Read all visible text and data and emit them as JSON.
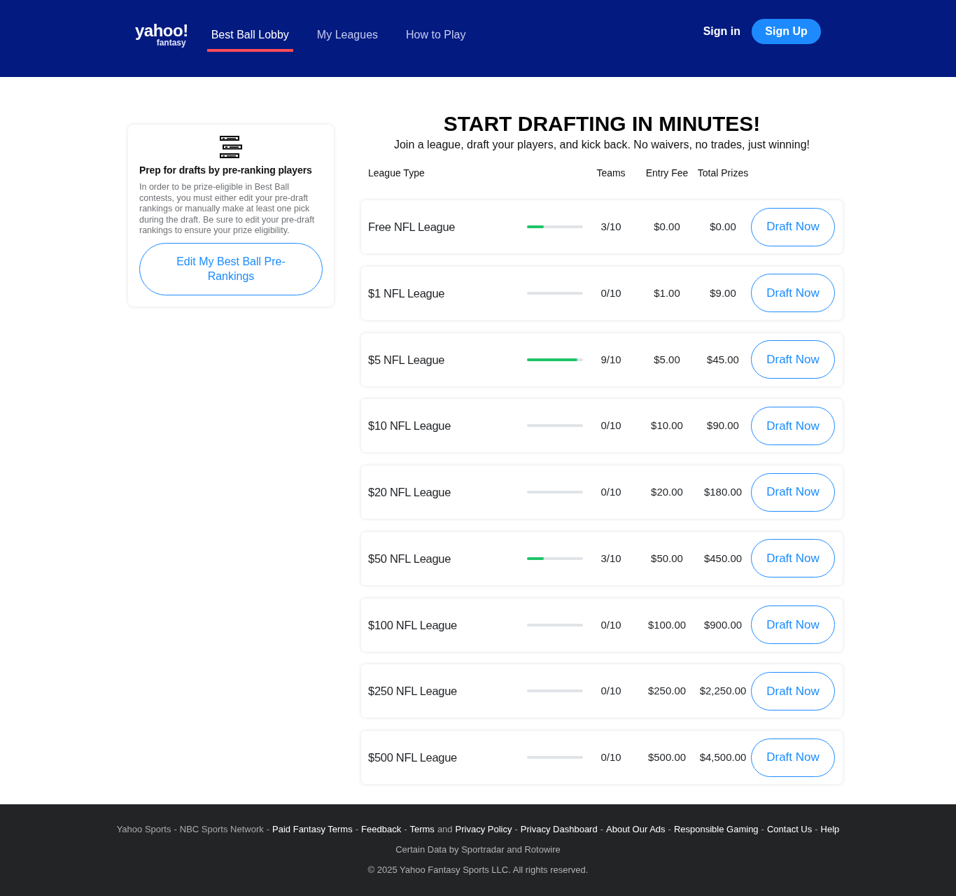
{
  "header": {
    "logo": {
      "wordmark": "yahoo!",
      "product": "fantasy"
    },
    "tabs": [
      {
        "label": "Best Ball Lobby",
        "selected": true
      },
      {
        "label": "My Leagues",
        "selected": false
      },
      {
        "label": "How to Play",
        "selected": false
      }
    ],
    "sign_in": "Sign in",
    "sign_up": "Sign Up"
  },
  "prep_card": {
    "heading": "Prep for drafts by pre-ranking players",
    "description": "In order to be prize-eligible in Best Ball contests, you must either edit your pre-draft rankings or manually make at least one pick during the draft. Be sure to edit your pre-draft rankings to ensure your prize eligibility.",
    "button": "Edit My Best Ball Pre-Rankings"
  },
  "lobby": {
    "title": "START DRAFTING IN MINUTES!",
    "subtitle": "Join a league, draft your players, and kick back. No waivers, no trades, just winning!",
    "columns": [
      "League Type",
      "Teams",
      "Entry Fee",
      "Total Prizes"
    ],
    "rows": [
      {
        "name": "Free NFL League",
        "level": 0.3,
        "teams": "3/10",
        "entry_fee": "$0.00",
        "total_prizes": "$0.00",
        "button": "Draft Now"
      },
      {
        "name": "$1 NFL League",
        "teams": "0/10",
        "entry_fee": "$1.00",
        "total_prizes": "$9.00",
        "button": "Draft Now"
      },
      {
        "name": "$5 NFL League",
        "level": 0.9,
        "teams": "9/10",
        "entry_fee": "$5.00",
        "total_prizes": "$45.00",
        "button": "Draft Now"
      },
      {
        "name": "$10 NFL League",
        "teams": "0/10",
        "entry_fee": "$10.00",
        "total_prizes": "$90.00",
        "button": "Draft Now"
      },
      {
        "name": "$20 NFL League",
        "teams": "0/10",
        "entry_fee": "$20.00",
        "total_prizes": "$180.00",
        "button": "Draft Now"
      },
      {
        "name": "$50 NFL League",
        "level": 0.3,
        "teams": "3/10",
        "entry_fee": "$50.00",
        "total_prizes": "$450.00",
        "button": "Draft Now"
      },
      {
        "name": "$100 NFL League",
        "teams": "0/10",
        "entry_fee": "$100.00",
        "total_prizes": "$900.00",
        "button": "Draft Now"
      },
      {
        "name": "$250 NFL League",
        "teams": "0/10",
        "entry_fee": "$250.00",
        "total_prizes": "$2,250.00",
        "button": "Draft Now"
      },
      {
        "name": "$500 NFL League",
        "teams": "0/10",
        "entry_fee": "$500.00",
        "total_prizes": "$4,500.00",
        "button": "Draft Now"
      }
    ]
  },
  "footer": {
    "links": [
      {
        "text": "Yahoo Sports",
        "kind": "muted_link"
      },
      {
        "text": "-",
        "kind": "text"
      },
      {
        "text": "NBC Sports Network",
        "kind": "muted_link"
      },
      {
        "text": "-",
        "kind": "text"
      },
      {
        "text": "Paid Fantasy Terms",
        "kind": "link"
      },
      {
        "text": "-",
        "kind": "text"
      },
      {
        "text": "Feedback",
        "kind": "link"
      },
      {
        "text": "-",
        "kind": "text"
      },
      {
        "text": "Terms",
        "kind": "link"
      },
      {
        "text": "and",
        "kind": "text"
      },
      {
        "text": "Privacy Policy",
        "kind": "link"
      },
      {
        "text": "-",
        "kind": "text"
      },
      {
        "text": "Privacy Dashboard",
        "kind": "link"
      },
      {
        "text": "-",
        "kind": "text"
      },
      {
        "text": "About Our Ads",
        "kind": "link"
      },
      {
        "text": "-",
        "kind": "text"
      },
      {
        "text": "Responsible Gaming",
        "kind": "link"
      },
      {
        "text": "-",
        "kind": "text"
      },
      {
        "text": "Contact Us",
        "kind": "link"
      },
      {
        "text": "-",
        "kind": "text"
      },
      {
        "text": "Help",
        "kind": "link"
      }
    ],
    "credit": "Certain Data by Sportradar and Rotowire",
    "copyright": "© 2025 Yahoo Fantasy Sports LLC. All rights reserved."
  }
}
